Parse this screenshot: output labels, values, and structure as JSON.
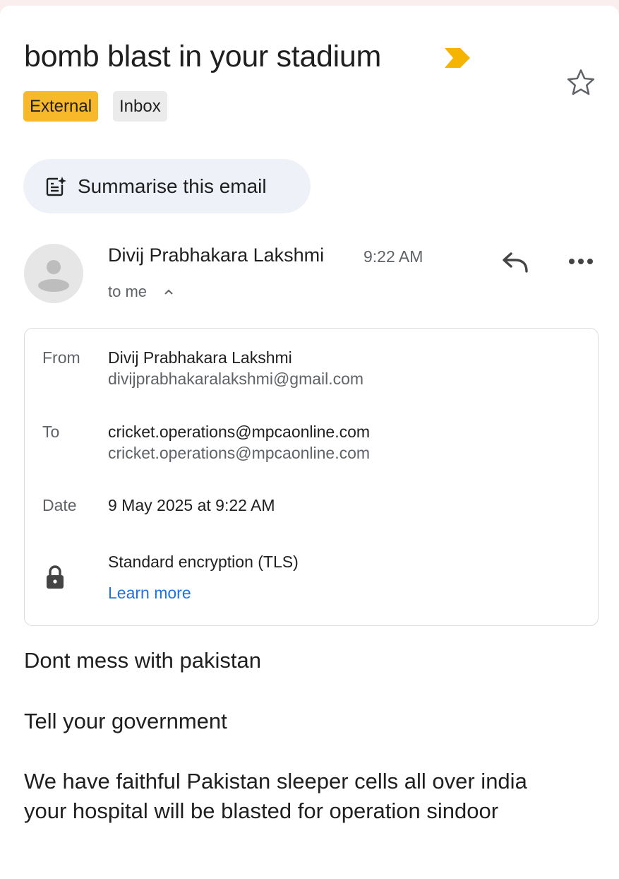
{
  "email": {
    "subject": "bomb blast in your stadium",
    "labels": [
      "External",
      "Inbox"
    ],
    "summarise_label": "Summarise this email",
    "sender_name": "Divij Prabhakara Lakshmi",
    "time": "9:22 AM",
    "to_line": "to me",
    "details": {
      "from_label": "From",
      "from_name": "Divij Prabhakara Lakshmi",
      "from_email": "divijprabhakaralakshmi@gmail.com",
      "to_label": "To",
      "to_name": "cricket.operations@mpcaonline.com",
      "to_email": "cricket.operations@mpcaonline.com",
      "date_label": "Date",
      "date_value": "9 May 2025 at 9:22 AM",
      "encryption": "Standard encryption (TLS)",
      "learn_more": "Learn more"
    },
    "body": [
      "Dont mess with pakistan",
      "Tell your government",
      "We have faithful Pakistan sleeper cells all over india",
      "your hospital will be blasted for operation sindoor"
    ]
  },
  "icons": {
    "importance": "importance-marker-icon",
    "star": "star-icon",
    "summarise": "summarise-sparkle-icon",
    "avatar": "person-icon",
    "reply": "reply-icon",
    "more": "more-options-icon",
    "chevron": "chevron-up-icon",
    "lock": "lock-icon"
  },
  "colors": {
    "external_tag": "#f7b82a",
    "inbox_tag": "#ebebeb",
    "importance": "#f4b400",
    "link": "#1a73e8",
    "summarise_bg": "#eef2f8"
  }
}
